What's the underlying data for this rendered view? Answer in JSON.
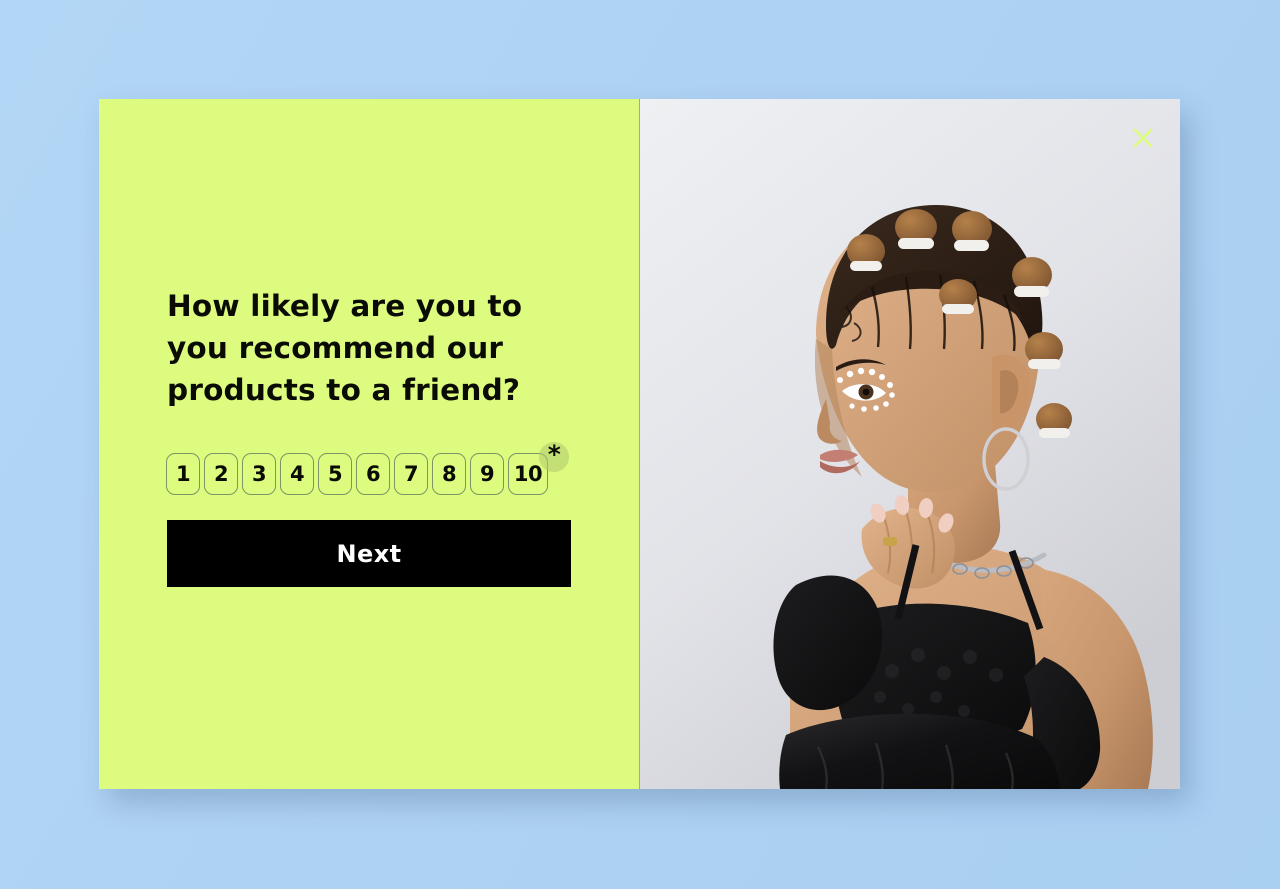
{
  "page": {
    "background_color": "#aed2f2"
  },
  "card": {
    "panel_color": "#dcfb7f",
    "accent_color": "#dcfb7f",
    "text_color": "#0b0b06"
  },
  "survey": {
    "question": "How likely are you to you recommend our products to a friend?",
    "required_marker": "*",
    "scale": {
      "options": [
        "1",
        "2",
        "3",
        "4",
        "5",
        "6",
        "7",
        "8",
        "9",
        "10"
      ],
      "min": 1,
      "max": 10,
      "selected": null
    },
    "next_label": "Next"
  },
  "close": {
    "icon": "close-icon",
    "label": "×",
    "color": "#dcfb7f"
  },
  "photo": {
    "alt": "Portrait of a woman with bantu knots, pearl eye makeup, hoop earring, black corset top, arm warmers and leather pants on a light gray studio backdrop",
    "background_color": "#e4e5ea"
  }
}
